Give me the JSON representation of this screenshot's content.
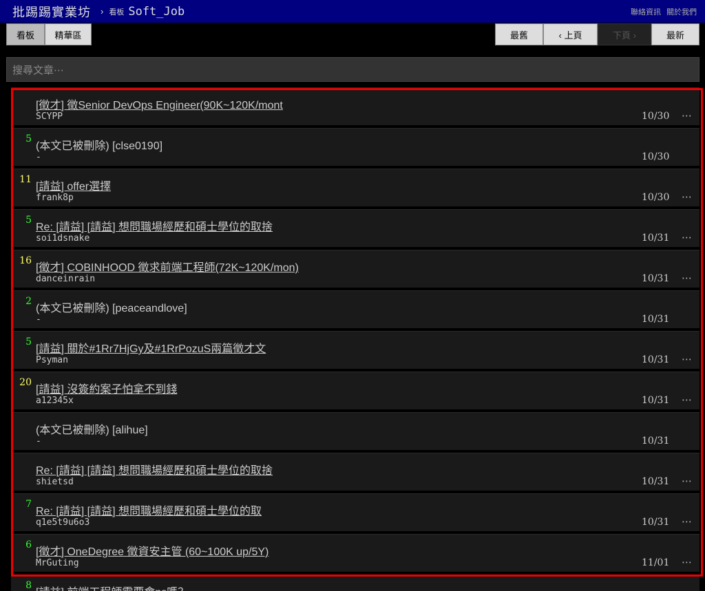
{
  "header": {
    "site_title": "批踢踢實業坊",
    "separator": "›",
    "board_kind": "看板",
    "board_name": "Soft_Job",
    "links": [
      "聯絡資訊",
      "關於我們"
    ]
  },
  "tabs": {
    "board": "看板",
    "digest": "精華區"
  },
  "pager": {
    "oldest": "最舊",
    "prev": "‹ 上頁",
    "next": "下頁 ›",
    "newest": "最新"
  },
  "search": {
    "placeholder": "搜尋文章⋯"
  },
  "posts": [
    {
      "nrec": "",
      "nrec_color": "",
      "title": "[徵才] 徵Senior DevOps Engineer(90K~120K/mont",
      "link": true,
      "author": "SCYPP",
      "date": "10/30",
      "more": "⋯"
    },
    {
      "nrec": "5",
      "nrec_color": "green",
      "title": "(本文已被刪除) [clse0190]",
      "link": false,
      "author": "-",
      "date": "10/30",
      "more": ""
    },
    {
      "nrec": "11",
      "nrec_color": "yellow",
      "title": "[請益] offer選擇",
      "link": true,
      "author": "frank8p",
      "date": "10/30",
      "more": "⋯"
    },
    {
      "nrec": "5",
      "nrec_color": "green",
      "title": "Re: [請益] [請益]  想問職場經歷和碩士學位的取捨",
      "link": true,
      "author": "soi1dsnake",
      "date": "10/31",
      "more": "⋯"
    },
    {
      "nrec": "16",
      "nrec_color": "yellow",
      "title": "[徵才] COBINHOOD 徵求前端工程師(72K~120K/mon)",
      "link": true,
      "author": "danceinrain",
      "date": "10/31",
      "more": "⋯"
    },
    {
      "nrec": "2",
      "nrec_color": "green",
      "title": "(本文已被刪除) [peaceandlove]",
      "link": false,
      "author": "-",
      "date": "10/31",
      "more": ""
    },
    {
      "nrec": "5",
      "nrec_color": "green",
      "title": "[請益] 關於#1Rr7HjGy及#1RrPozuS兩篇徵才文",
      "link": true,
      "author": "Psyman",
      "date": "10/31",
      "more": "⋯"
    },
    {
      "nrec": "20",
      "nrec_color": "yellow",
      "title": "[請益] 沒簽約案子怕拿不到錢",
      "link": true,
      "author": "a12345x",
      "date": "10/31",
      "more": "⋯"
    },
    {
      "nrec": "",
      "nrec_color": "",
      "title": "(本文已被刪除) [alihue]",
      "link": false,
      "author": "-",
      "date": "10/31",
      "more": ""
    },
    {
      "nrec": "",
      "nrec_color": "",
      "title": "Re: [請益] [請益]  想問職場經歷和碩士學位的取捨",
      "link": true,
      "author": "shietsd",
      "date": "10/31",
      "more": "⋯"
    },
    {
      "nrec": "7",
      "nrec_color": "green",
      "title": "Re: [請益] [請益]  想問職場經歷和碩士學位的取",
      "link": true,
      "author": "q1e5t9u6o3",
      "date": "10/31",
      "more": "⋯"
    },
    {
      "nrec": "6",
      "nrec_color": "green",
      "title": "[徵才] OneDegree 徵資安主管 (60~100K up/5Y)",
      "link": true,
      "author": "MrGuting",
      "date": "11/01",
      "more": "⋯"
    },
    {
      "nrec": "8",
      "nrec_color": "green",
      "title": "[請益] 前端工程師需要會ps嗎？",
      "link": true,
      "author": "",
      "date": "",
      "more": ""
    }
  ],
  "colors": {
    "topbar": "#000080",
    "highlight": "#ee0000",
    "green": "#33ff33",
    "yellow": "#ffff66"
  }
}
